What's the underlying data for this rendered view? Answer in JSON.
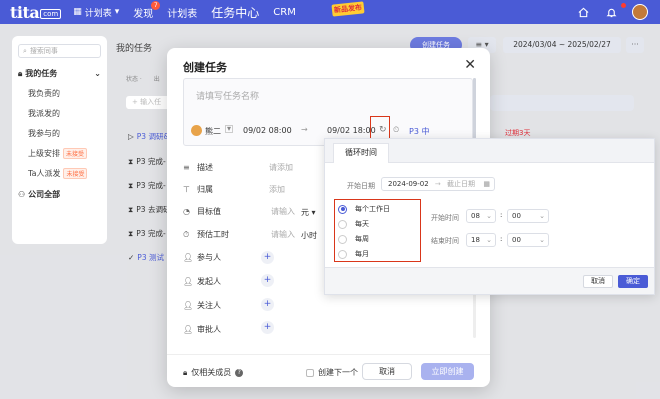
{
  "topbar": {
    "logo": "tita",
    "logo_sub": "com",
    "plan_label": "计划表",
    "nav": [
      "发现",
      "计划表",
      "任务中心",
      "CRM"
    ],
    "discover_badge": "7",
    "promo": "新品发布"
  },
  "background": {
    "title": "我的任务",
    "search_placeholder": "搜索同事",
    "my_tasks": "我的任务",
    "items": [
      "我负责的",
      "我派发的",
      "我参与的",
      "上级安排",
      "Ta人派发"
    ],
    "not_accepted": "未接受",
    "company": "公司全部",
    "filter_status": "状态 ·",
    "filter_frag": "出",
    "add_task": "+ 输入任",
    "create_task": "创建任务",
    "view": "≡ ▾",
    "date_range": "2024/03/04 ~ 2025/02/27",
    "more": "···",
    "rows": [
      "P3 调研&",
      "P3 完成-",
      "P3 完成-",
      "P3 去调研",
      "P3 完成-",
      "P3 测试"
    ],
    "due_frag": "过期3天"
  },
  "modal": {
    "title": "创建任务",
    "name_placeholder": "请填写任务名称",
    "owner": "熊二",
    "start": "09/02 08:00",
    "arrow": "→",
    "end": "09/02 18:00",
    "priority": "P3 中",
    "fields": [
      {
        "label": "描述",
        "value": "请添加"
      },
      {
        "label": "归属",
        "value": "添加"
      },
      {
        "label": "目标值",
        "value": "请输入"
      },
      {
        "label": "预估工时",
        "value": "请输入"
      }
    ],
    "unit_yuan": "元 ▾",
    "unit_hour": "小时",
    "people": [
      "参与人",
      "发起人",
      "关注人",
      "审批人"
    ],
    "related_only": "仅相关成员",
    "create_next": "创建下一个",
    "cancel": "取消",
    "submit": "立即创建"
  },
  "repeat_popup": {
    "tab": "循环时间",
    "start_label": "开始日期",
    "start_value": "2024-09-02",
    "end_placeholder": "截止日期",
    "options": [
      "每个工作日",
      "每天",
      "每周",
      "每月"
    ],
    "selected": 0,
    "start_time_label": "开始时间",
    "start_hour": "08",
    "start_min": "00",
    "end_time_label": "结束时间",
    "end_hour": "18",
    "end_min": "00",
    "cancel": "取消",
    "confirm": "确定"
  }
}
